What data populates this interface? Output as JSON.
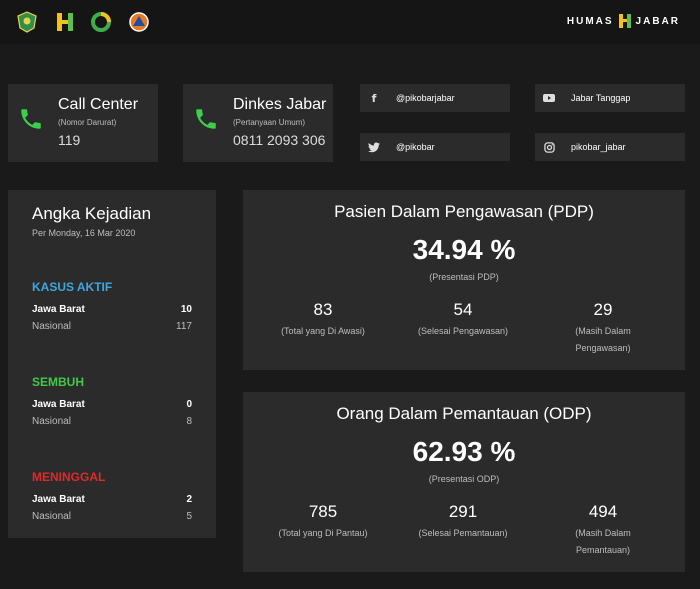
{
  "brand": {
    "text_left": "HUMAS",
    "text_right": "JABAR"
  },
  "contacts": [
    {
      "title": "Call Center",
      "subtitle": "(Nomor Darurat)",
      "number": "119"
    },
    {
      "title": "Dinkes Jabar",
      "subtitle": "(Pertanyaan Umum)",
      "number": "0811 2093 306"
    }
  ],
  "social": {
    "facebook": "@pikobarjabar",
    "youtube": "Jabar Tanggap",
    "twitter": "@pikobar",
    "instagram": "pikobar_jabar"
  },
  "incidents": {
    "title": "Angka Kejadian",
    "date": "Per Monday, 16 Mar 2020",
    "sections": [
      {
        "label": "KASUS AKTIF",
        "color": "#3fa7e0",
        "rows": [
          {
            "label": "Jawa Barat",
            "value": "10"
          },
          {
            "label": "Nasional",
            "value": "117"
          }
        ]
      },
      {
        "label": "SEMBUH",
        "color": "#43c94a",
        "rows": [
          {
            "label": "Jawa Barat",
            "value": "0"
          },
          {
            "label": "Nasional",
            "value": "8"
          }
        ]
      },
      {
        "label": "MENINGGAL",
        "color": "#e02a2a",
        "rows": [
          {
            "label": "Jawa Barat",
            "value": "2"
          },
          {
            "label": "Nasional",
            "value": "5"
          }
        ]
      }
    ]
  },
  "pdp": {
    "title": "Pasien Dalam Pengawasan (PDP)",
    "percent": "34.94 %",
    "percent_label": "(Presentasi PDP)",
    "stats": [
      {
        "value": "83",
        "label": "(Total yang Di Awasi)"
      },
      {
        "value": "54",
        "label": "(Selesai Pengawasan)"
      },
      {
        "value": "29",
        "label_1": "(Masih Dalam",
        "label_2": "Pengawasan)"
      }
    ]
  },
  "odp": {
    "title": "Orang Dalam Pemantauan (ODP)",
    "percent": "62.93 %",
    "percent_label": "(Presentasi ODP)",
    "stats": [
      {
        "value": "785",
        "label": "(Total yang Di Pantau)"
      },
      {
        "value": "291",
        "label": "(Selesai Pemantauan)"
      },
      {
        "value": "494",
        "label_1": "(Masih Dalam",
        "label_2": "Pemantauan)"
      }
    ]
  },
  "colors": {
    "phone_green": "#3ecf4a",
    "accent_yellow": "#f2c21b",
    "accent_green": "#5fbf4a"
  }
}
